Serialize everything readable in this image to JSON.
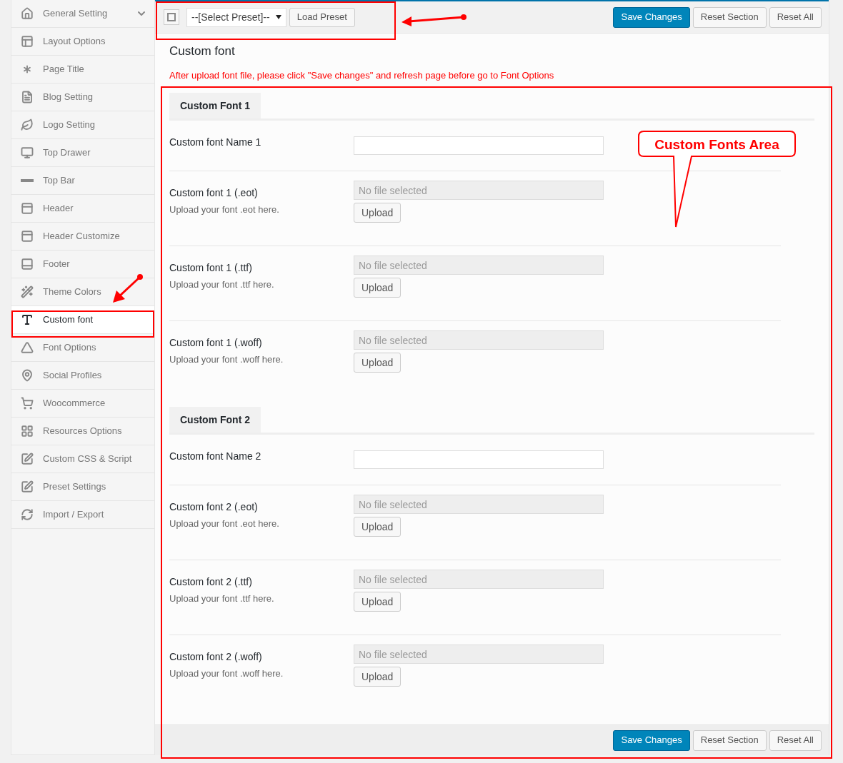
{
  "sidebar": {
    "items": [
      {
        "label": "General Setting",
        "selected": false,
        "expandable": true
      },
      {
        "label": "Layout Options",
        "selected": false,
        "expandable": false
      },
      {
        "label": "Page Title",
        "selected": false,
        "expandable": false
      },
      {
        "label": "Blog Setting",
        "selected": false,
        "expandable": false
      },
      {
        "label": "Logo Setting",
        "selected": false,
        "expandable": false
      },
      {
        "label": "Top Drawer",
        "selected": false,
        "expandable": false
      },
      {
        "label": "Top Bar",
        "selected": false,
        "expandable": false
      },
      {
        "label": "Header",
        "selected": false,
        "expandable": false
      },
      {
        "label": "Header Customize",
        "selected": false,
        "expandable": false
      },
      {
        "label": "Footer",
        "selected": false,
        "expandable": false
      },
      {
        "label": "Theme Colors",
        "selected": false,
        "expandable": false
      },
      {
        "label": "Custom font",
        "selected": true,
        "expandable": false
      },
      {
        "label": "Font Options",
        "selected": false,
        "expandable": false
      },
      {
        "label": "Social Profiles",
        "selected": false,
        "expandable": false
      },
      {
        "label": "Woocommerce",
        "selected": false,
        "expandable": false
      },
      {
        "label": "Resources Options",
        "selected": false,
        "expandable": false
      },
      {
        "label": "Custom CSS & Script",
        "selected": false,
        "expandable": false
      },
      {
        "label": "Preset Settings",
        "selected": false,
        "expandable": false
      },
      {
        "label": "Import / Export",
        "selected": false,
        "expandable": false
      }
    ]
  },
  "toolbar": {
    "preset_select": "--[Select Preset]--",
    "load_button": "Load Preset",
    "buttons": [
      {
        "label": "Save Changes",
        "kind": "primary"
      },
      {
        "label": "Reset Section",
        "kind": "secondary"
      },
      {
        "label": "Reset All",
        "kind": "secondary"
      }
    ]
  },
  "section_title": "Custom font",
  "notice": "After upload font file, please click \"Save changes\" and refresh page before go to Font Options",
  "groups": [
    {
      "tab": "Custom Font 1",
      "fields": [
        {
          "kind": "text",
          "label": "Custom font Name 1"
        },
        {
          "kind": "upload",
          "label": "Custom font 1 (.eot)",
          "description": "Upload your font .eot here.",
          "placeholder": "No file selected",
          "button": "Upload"
        },
        {
          "kind": "upload",
          "label": "Custom font 1 (.ttf)",
          "description": "Upload your font .ttf here.",
          "placeholder": "No file selected",
          "button": "Upload"
        },
        {
          "kind": "upload",
          "label": "Custom font 1 (.woff)",
          "description": "Upload your font .woff here.",
          "placeholder": "No file selected",
          "button": "Upload"
        }
      ]
    },
    {
      "tab": "Custom Font 2",
      "fields": [
        {
          "kind": "text",
          "label": "Custom font Name 2"
        },
        {
          "kind": "upload",
          "label": "Custom font 2 (.eot)",
          "description": "Upload your font .eot here.",
          "placeholder": "No file selected",
          "button": "Upload"
        },
        {
          "kind": "upload",
          "label": "Custom font 2 (.ttf)",
          "description": "Upload your font .ttf here.",
          "placeholder": "No file selected",
          "button": "Upload"
        },
        {
          "kind": "upload",
          "label": "Custom font 2 (.woff)",
          "description": "Upload your font .woff here.",
          "placeholder": "No file selected",
          "button": "Upload"
        }
      ]
    }
  ],
  "footer": {
    "buttons": [
      {
        "label": "Save Changes",
        "kind": "primary"
      },
      {
        "label": "Reset Section",
        "kind": "secondary"
      },
      {
        "label": "Reset All",
        "kind": "secondary"
      }
    ]
  },
  "annotation": {
    "callout": "Custom Fonts Area"
  }
}
